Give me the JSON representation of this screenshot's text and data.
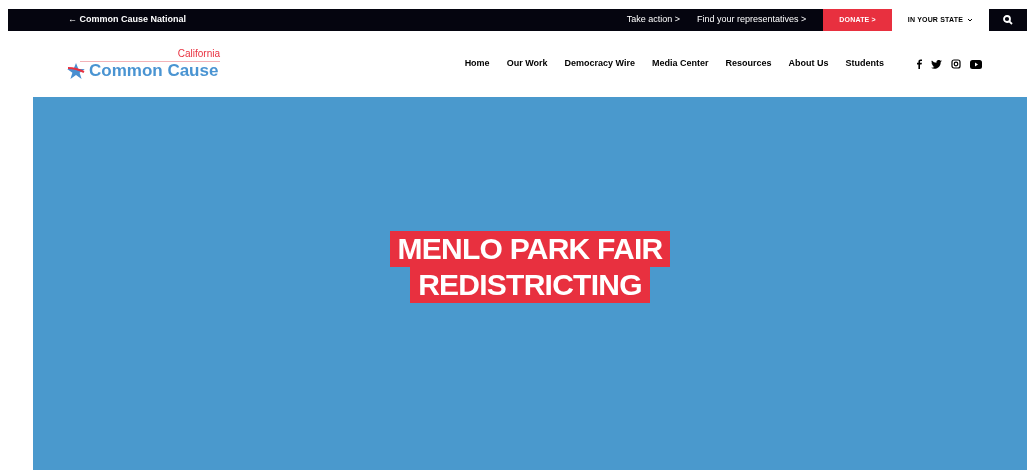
{
  "top_bar": {
    "back_link": "← Common Cause National",
    "links": [
      "Take action >",
      "Find your representatives >"
    ],
    "donate": "DONATE >",
    "state_menu": "IN YOUR STATE"
  },
  "logo": {
    "state": "California",
    "name": "Common Cause"
  },
  "nav": [
    "Home",
    "Our Work",
    "Democracy Wire",
    "Media Center",
    "Resources",
    "About Us",
    "Students"
  ],
  "hero": {
    "title_lines": [
      "MENLO PARK FAIR",
      "REDISTRICTING"
    ]
  }
}
